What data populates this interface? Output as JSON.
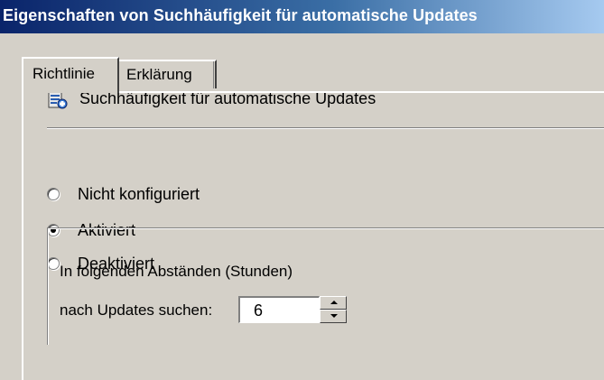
{
  "window": {
    "title": "Eigenschaften von Suchhäufigkeit für automatische Updates"
  },
  "tabs": [
    {
      "label": "Richtlinie",
      "active": true
    },
    {
      "label": "Erklärung",
      "active": false
    }
  ],
  "policy": {
    "icon": "policy-setting-icon",
    "name": "Suchhäufigkeit für automatische Updates"
  },
  "options": [
    {
      "label": "Nicht konfiguriert",
      "selected": false
    },
    {
      "label": "Aktiviert",
      "selected": true
    },
    {
      "label": "Deaktiviert",
      "selected": false
    }
  ],
  "settings": {
    "line1": "In folgenden Abständen (Stunden)",
    "line2": "nach Updates suchen:",
    "value": "6"
  },
  "colors": {
    "title_start": "#0a246a",
    "title_end": "#a6caf0",
    "face": "#d4d0c8"
  }
}
